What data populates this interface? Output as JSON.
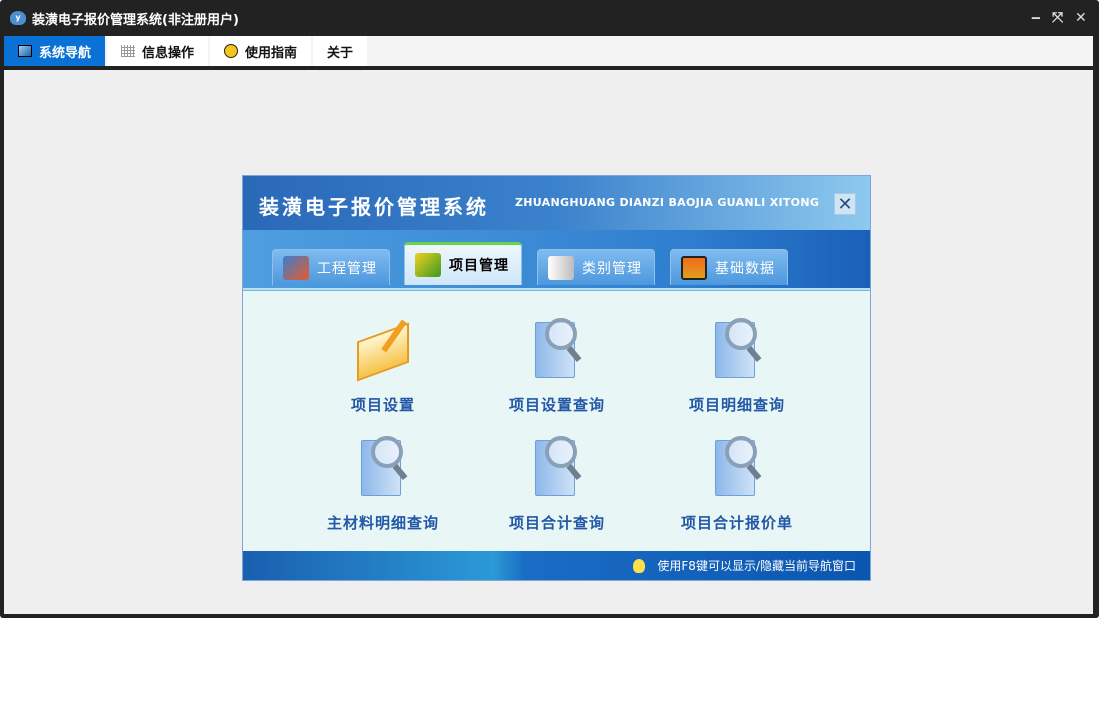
{
  "window": {
    "title": "装潢电子报价管理系统(非注册用户)",
    "controls": {
      "minimize": "‒",
      "restore": "⤧",
      "close": "✕"
    }
  },
  "menu": [
    {
      "label": "系统导航",
      "icon": "monitor-icon",
      "active": true
    },
    {
      "label": "信息操作",
      "icon": "grid-icon"
    },
    {
      "label": "使用指南",
      "icon": "help-icon"
    },
    {
      "label": "关于"
    }
  ],
  "panel": {
    "title": "装潢电子报价管理系统",
    "subtitle": "ZHUANGHUANG DIANZI BAOJIA GUANLI XITONG",
    "close": "✕",
    "tabs": [
      {
        "label": "工程管理",
        "icon": "house-icon"
      },
      {
        "label": "项目管理",
        "icon": "cube-icon",
        "active": true
      },
      {
        "label": "类别管理",
        "icon": "book-icon"
      },
      {
        "label": "基础数据",
        "icon": "monitor-icon"
      }
    ],
    "items": [
      {
        "label": "项目设置",
        "icon": "notebook-pen-icon"
      },
      {
        "label": "项目设置查询",
        "icon": "document-search-icon"
      },
      {
        "label": "项目明细查询",
        "icon": "document-search-icon"
      },
      {
        "label": "主材料明细查询",
        "icon": "document-search-icon"
      },
      {
        "label": "项目合计查询",
        "icon": "document-search-icon"
      },
      {
        "label": "项目合计报价单",
        "icon": "document-search-icon"
      }
    ],
    "footer": "使用F8键可以显示/隐藏当前导航窗口"
  }
}
